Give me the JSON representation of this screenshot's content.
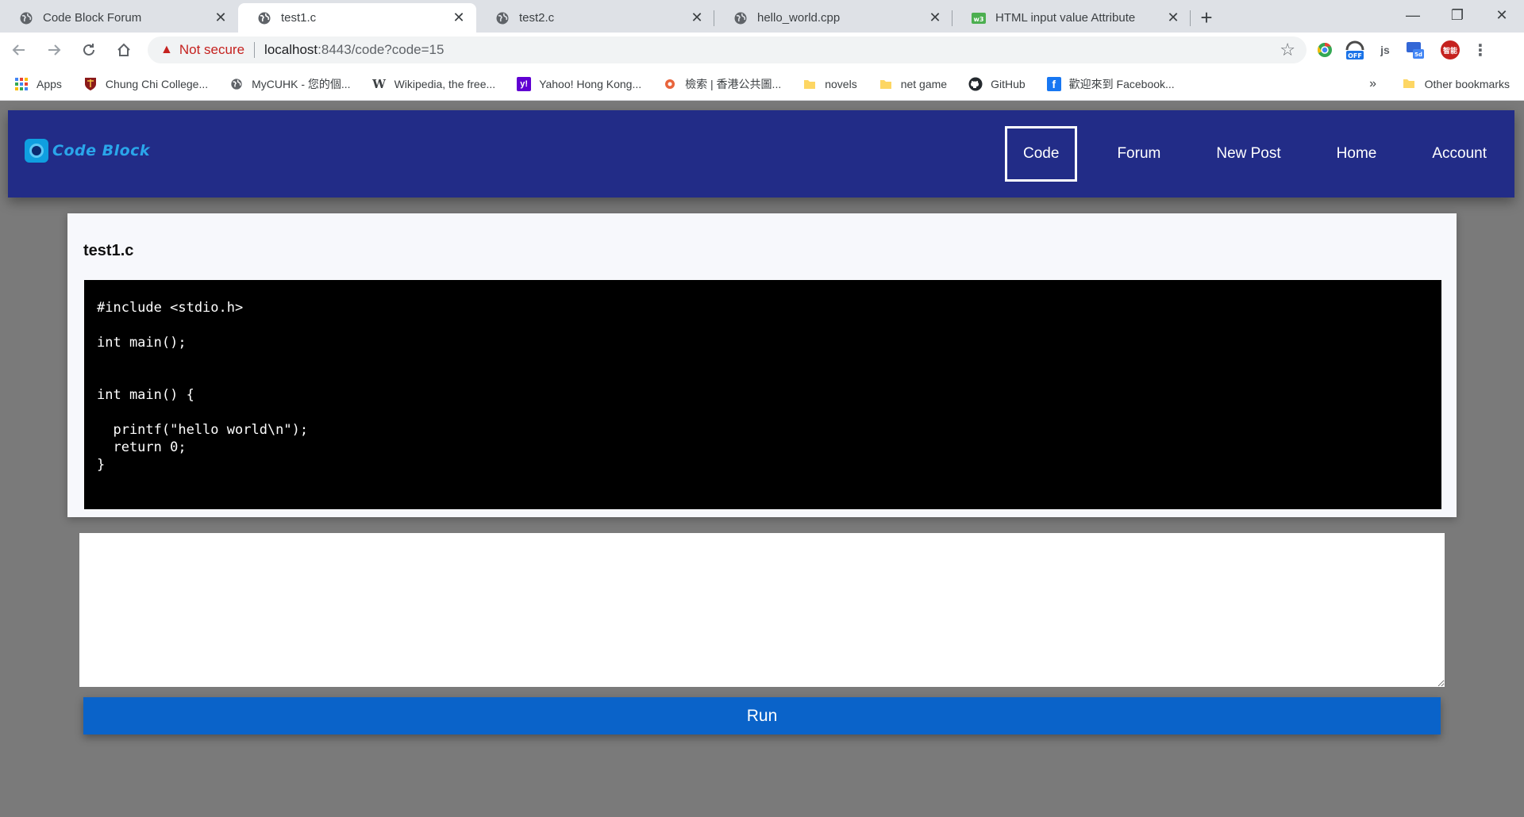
{
  "browser": {
    "tabs": [
      {
        "title": "Code Block Forum",
        "icon": "globe-icon"
      },
      {
        "title": "test1.c",
        "icon": "globe-icon",
        "active": true
      },
      {
        "title": "test2.c",
        "icon": "globe-icon"
      },
      {
        "title": "hello_world.cpp",
        "icon": "globe-icon"
      },
      {
        "title": "HTML input value Attribute",
        "icon": "w3schools-icon"
      }
    ],
    "security_label": "Not secure",
    "url_host": "localhost",
    "url_rest": ":8443/code?code=15",
    "extensions": {
      "off_badge": "OFF",
      "js_label": "js",
      "sd_badge": "5d",
      "profile_label": "智能"
    },
    "bookmarks": [
      {
        "label": "Apps",
        "icon": "apps-grid-icon"
      },
      {
        "label": "Chung Chi College...",
        "icon": "crest-icon"
      },
      {
        "label": "MyCUHK - 您的個...",
        "icon": "globe-icon"
      },
      {
        "label": "Wikipedia, the free...",
        "icon": "wikipedia-icon",
        "glyph": "W"
      },
      {
        "label": "Yahoo! Hong Kong...",
        "icon": "yahoo-icon",
        "glyph": "y!"
      },
      {
        "label": "檢索 | 香港公共圖...",
        "icon": "library-icon"
      },
      {
        "label": "novels",
        "icon": "folder-icon"
      },
      {
        "label": "net game",
        "icon": "folder-icon"
      },
      {
        "label": "GitHub",
        "icon": "github-icon"
      },
      {
        "label": "歡迎來到 Facebook...",
        "icon": "facebook-icon",
        "glyph": "f"
      }
    ],
    "bookmarks_more": "»",
    "other_bookmarks": "Other bookmarks"
  },
  "site": {
    "logo_text": "Code Block",
    "menu": [
      {
        "label": "Code",
        "active": true
      },
      {
        "label": "Forum"
      },
      {
        "label": "New Post"
      },
      {
        "label": "Home"
      },
      {
        "label": "Account"
      }
    ]
  },
  "code": {
    "title": "test1.c",
    "content": "#include <stdio.h>\n\nint main();\n\n\nint main() {\n\n  printf(\"hello world\\n\");\n  return 0;\n}"
  },
  "output": {
    "value": ""
  },
  "run_label": "Run",
  "colors": {
    "nav_bg": "#222c87",
    "page_bg": "#7a7a7a",
    "run_button": "#0a63c9",
    "code_bg": "#000000"
  }
}
